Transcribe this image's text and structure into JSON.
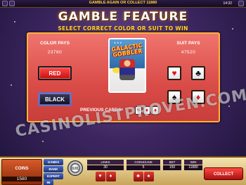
{
  "topbar": {
    "message": "GAMBLE AGAIN OR COLLECT 11880",
    "time": "14:32"
  },
  "title": "GAMBLE FEATURE",
  "subtitle": "SELECT CORRECT COLOR OR SUIT TO WIN",
  "panel": {
    "color_pays_label": "COLOR PAYS",
    "color_pays_value": "23760",
    "suit_pays_label": "SUIT PAYS",
    "suit_pays_value": "47520",
    "red_label": "RED",
    "black_label": "BLACK",
    "card_title": "GALACTIC GOBBLER",
    "previous_cards_label": "PREVIOUS CARDS",
    "previous_cards": [
      "♥",
      "♦",
      "♦"
    ],
    "suits": [
      {
        "name": "hearts",
        "glyph": "♥",
        "color": "#d81a1a"
      },
      {
        "name": "clubs",
        "glyph": "♣",
        "color": "#111111"
      },
      {
        "name": "spades",
        "glyph": "♠",
        "color": "#111111"
      },
      {
        "name": "diamonds",
        "glyph": "♦",
        "color": "#d81a1a"
      }
    ]
  },
  "watermark": "CASINOLISTPROVEN.COM",
  "bottom": {
    "coins_label": "COINS",
    "coins_value": "1580",
    "mode_buttons": [
      "GAMES",
      "BANK",
      "EXPERT",
      "96"
    ],
    "chip_value": "0.01",
    "lines_label": "LINES",
    "lines_value": "30",
    "coins_line_label": "COINS/LINE",
    "coins_line_value": "5",
    "bet_label": "BET",
    "bet_value": "150",
    "win_label": "WIN",
    "win_value": "11880",
    "collect_label": "COLLECT"
  },
  "colors": {
    "panel": "#d94b47",
    "title_glow": "#e07a10",
    "subtitle": "#ffd23a"
  }
}
